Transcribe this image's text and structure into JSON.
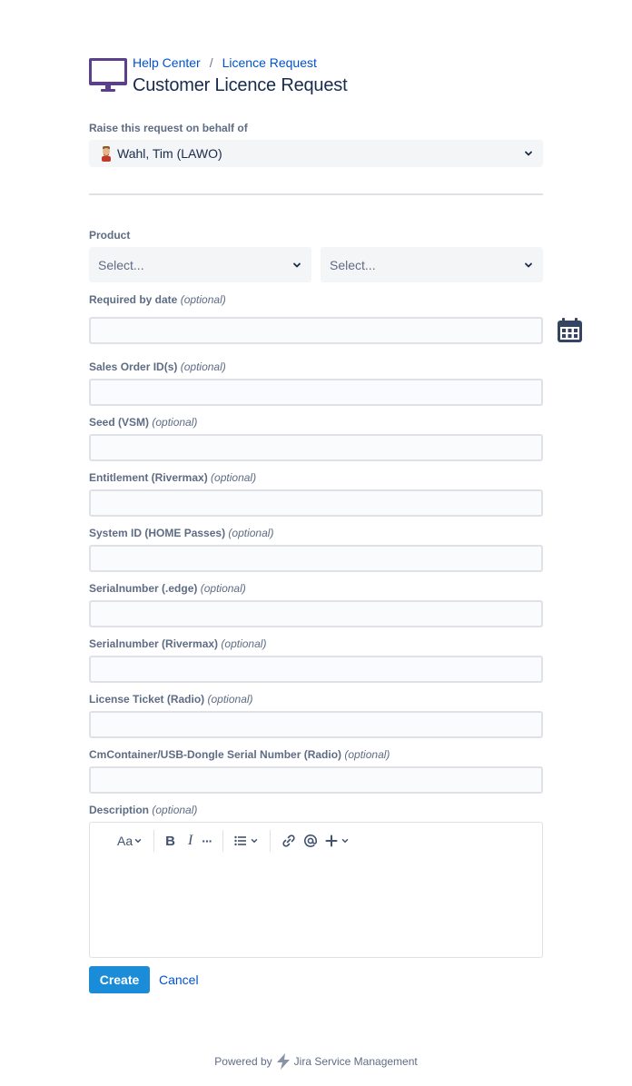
{
  "breadcrumb": {
    "home": "Help Center",
    "separator": "/",
    "current": "Licence Request"
  },
  "page_title": "Customer Licence Request",
  "behalf": {
    "label": "Raise this request on behalf of",
    "value": "Wahl, Tim (LAWO)"
  },
  "product": {
    "label": "Product",
    "select1_placeholder": "Select...",
    "select2_placeholder": "Select..."
  },
  "optional_text": "(optional)",
  "fields": {
    "required_by_date": "Required by date",
    "sales_order": "Sales Order ID(s)",
    "seed": "Seed (VSM)",
    "entitlement": "Entitlement (Rivermax)",
    "system_id": "System ID (HOME Passes)",
    "serial_edge": "Serialnumber (.edge)",
    "serial_rivermax": "Serialnumber (Rivermax)",
    "license_ticket": "License Ticket (Radio)",
    "cmcontainer": "CmContainer/USB-Dongle Serial Number (Radio)",
    "description": "Description"
  },
  "toolbar": {
    "text_style": "Aa",
    "bold": "B",
    "italic": "I",
    "more": "···"
  },
  "actions": {
    "create": "Create",
    "cancel": "Cancel"
  },
  "footer": {
    "powered_by": "Powered by",
    "product": "Jira Service Management"
  },
  "colors": {
    "link": "#0052cc",
    "primary_button": "#1a8cd8",
    "logo": "#5e4db2"
  }
}
